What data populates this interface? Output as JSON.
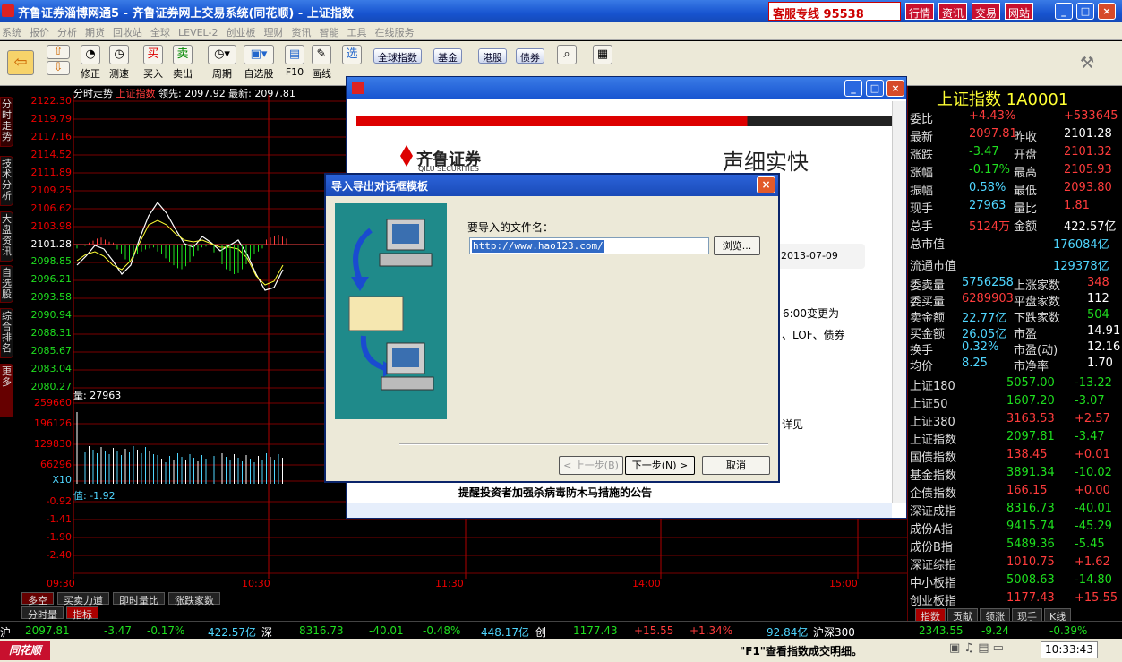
{
  "window": {
    "title": "齐鲁证券淄博网通5 - 齐鲁证券网上交易系统(同花顺) - 上证指数",
    "hotline": "客服专线 95538",
    "top_menus": [
      "行情",
      "资讯",
      "交易",
      "网站"
    ],
    "win_btns": [
      "_",
      "□",
      "×"
    ]
  },
  "menubar": [
    "系统",
    "报价",
    "分析",
    "期货",
    "回收站",
    "全球",
    "LEVEL-2",
    "创业板",
    "理财",
    "资讯",
    "智能",
    "工具",
    "在线服务"
  ],
  "toolbar": {
    "buttons": [
      "修正",
      "测速",
      "买入",
      "卖出",
      "周期",
      "自选股",
      "F10",
      "画线"
    ],
    "pills": [
      "全球指数",
      "基金",
      "港股",
      "债券"
    ]
  },
  "sidetabs": [
    "分时走势",
    "技术分析",
    "大盘资讯",
    "自选股",
    "综合排名",
    "更多"
  ],
  "chart": {
    "header_a": "分时走势",
    "header_b": "上证指数",
    "header_c": "领先: 2097.92 最新: 2097.81",
    "price_ticks": [
      "2122.30",
      "2119.79",
      "2117.16",
      "2114.52",
      "2111.89",
      "2109.25",
      "2106.62",
      "2103.98",
      "2101.28",
      "2098.85",
      "2096.21",
      "2093.58",
      "2090.94",
      "2088.31",
      "2085.67",
      "2083.04",
      "2080.27"
    ],
    "vol_label": "量: 27963",
    "vol_ticks": [
      "259660",
      "196126",
      "129830",
      "66296"
    ],
    "vol_unit": "X10",
    "diff_label": "值: -1.92",
    "diff_ticks": [
      "-0.92",
      "-1.41",
      "-1.90",
      "-2.40"
    ],
    "time_ticks": [
      "09:30",
      "10:30",
      "11:30",
      "14:00",
      "15:00"
    ]
  },
  "chart_data": {
    "type": "line",
    "title": "上证指数",
    "x": [
      "09:30",
      "10:30",
      "11:30",
      "14:00",
      "15:00"
    ],
    "ylim": [
      2080.27,
      2122.3
    ],
    "prev_close": 2101.28,
    "latest": 2097.81
  },
  "bottom_tabs": [
    "多空",
    "买卖力道",
    "即时量比",
    "涨跌家数",
    "分时量",
    "指标"
  ],
  "right": {
    "title": "上证指数 1A0001",
    "rows": [
      [
        "委比",
        "+4.43%",
        "",
        "+533645"
      ],
      [
        "最新",
        "2097.81",
        "昨收",
        "2101.28"
      ],
      [
        "涨跌",
        "-3.47",
        "开盘",
        "2101.32"
      ],
      [
        "涨幅",
        "-0.17%",
        "最高",
        "2105.93"
      ],
      [
        "振幅",
        "0.58%",
        "最低",
        "2093.80"
      ],
      [
        "现手",
        "27963",
        "量比",
        "1.81"
      ],
      [
        "总手",
        "5124万",
        "金额",
        "422.57亿"
      ]
    ],
    "total_cap": [
      "总市值",
      "176084亿"
    ],
    "float_cap": [
      "流通市值",
      "129378亿"
    ],
    "stats": [
      [
        "委卖量",
        "5756258",
        "上涨家数",
        "348"
      ],
      [
        "委买量",
        "6289903",
        "平盘家数",
        "112"
      ],
      [
        "卖金额",
        "22.77亿",
        "下跌家数",
        "504"
      ],
      [
        "买金额",
        "26.05亿",
        "市盈",
        "14.91"
      ],
      [
        "换手",
        "0.32%",
        "市盈(动)",
        "12.16"
      ],
      [
        "均价",
        "8.25",
        "市净率",
        "1.70"
      ]
    ],
    "indices": [
      [
        "上证180",
        "5057.00",
        "-13.22"
      ],
      [
        "上证50",
        "1607.20",
        "-3.07"
      ],
      [
        "上证380",
        "3163.53",
        "+2.57"
      ],
      [
        "上证指数",
        "2097.81",
        "-3.47"
      ],
      [
        "国债指数",
        "138.45",
        "+0.01"
      ],
      [
        "基金指数",
        "3891.34",
        "-10.02"
      ],
      [
        "企债指数",
        "166.15",
        "+0.00"
      ],
      [
        "深证成指",
        "8316.73",
        "-40.01"
      ],
      [
        "成份A指",
        "9415.74",
        "-45.29"
      ],
      [
        "成份B指",
        "5489.36",
        "-5.45"
      ],
      [
        "深证综指",
        "1010.75",
        "+1.62"
      ],
      [
        "中小板指",
        "5008.63",
        "-14.80"
      ],
      [
        "创业板指",
        "1177.43",
        "+15.55"
      ]
    ],
    "tabs": [
      "指数",
      "贡献",
      "领涨",
      "现手",
      "K线"
    ]
  },
  "status": [
    "沪",
    "2097.81",
    "-3.47",
    "-0.17%",
    "422.57亿",
    "深",
    "8316.73",
    "-40.01",
    "-0.48%",
    "448.17亿",
    "创",
    "1177.43",
    "+15.55",
    "+1.34%",
    "92.84亿",
    "沪深300",
    "2343.55",
    "-9.24",
    "-0.39%"
  ],
  "taskbar": {
    "logo": "同花顺",
    "hint": "\"F1\"查看指数成交明细。",
    "time": "10:33:43"
  },
  "browser": {
    "brand": "齐鲁证券",
    "brand_en": "QILU SECURITIES",
    "slogan": "声细实快",
    "date": "2013-07-09",
    "line1": "6:00变更为",
    "line2": "、LOF、债券",
    "line3": "详见",
    "notice": "提醒投资者加强杀病毒防木马措施的公告"
  },
  "dialog": {
    "title": "导入导出对话框模板",
    "label": "要导入的文件名：",
    "url": "http://www.hao123.com/",
    "browse": "浏览...",
    "prev": "< 上一步(B)",
    "next": "下一步(N) >",
    "cancel": "取消"
  }
}
